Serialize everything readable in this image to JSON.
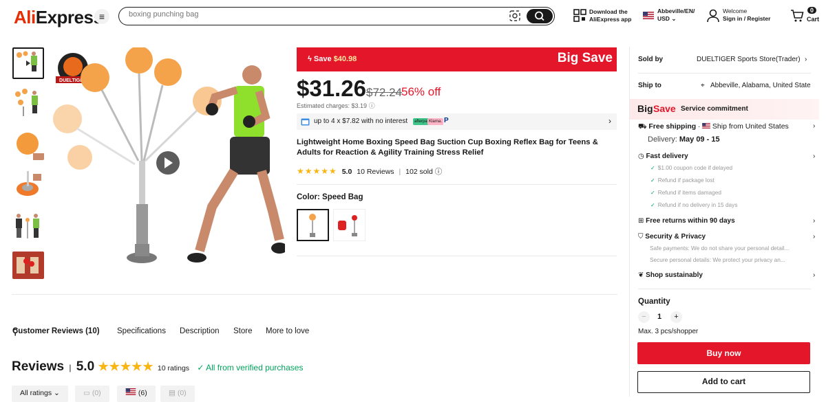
{
  "header": {
    "logo": "AliExpress",
    "search_placeholder": "boxing punching bag",
    "download_line1": "Download the",
    "download_line2": "AliExpress app",
    "locale_line1": "Abbeville/EN/",
    "locale_line2": "USD",
    "welcome": "Welcome",
    "signin": "Sign in / Register",
    "cart_count": "0",
    "cart_label": "Cart"
  },
  "price": {
    "save_prefix": "Save",
    "save_amount": "$40.98",
    "big_save": "Big Save",
    "current": "$31.26",
    "original": "$72.24",
    "discount": "56% off",
    "charges": "Estimated charges: $3.19",
    "installment": "up to 4 x $7.82 with no interest",
    "pay_afterpay": "afterpay",
    "pay_klarna": "Klarna."
  },
  "product": {
    "title": "Lightweight Home Boxing Speed Bag Suction Cup Boxing Reflex Bag for Teens & Adults for Reaction & Agility Training Stress Relief",
    "rating": "5.0",
    "reviews": "10 Reviews",
    "sold": "102 sold",
    "color_label": "Color: Speed Bag",
    "brand_badge": "DUELTIGER"
  },
  "panel": {
    "sold_by_label": "Sold by",
    "sold_by_value": "DUELTIGER Sports Store(Trader)",
    "ship_to_label": "Ship to",
    "ship_to_value": "Abbeville, Alabama, United States",
    "big": "Big",
    "save": "Save",
    "service": "Service commitment",
    "free_shipping": "Free shipping",
    "ship_from": "Ship from United States",
    "delivery_label": "Delivery:",
    "delivery_dates": "May 09 - 15",
    "fast_delivery": "Fast delivery",
    "fast_items": [
      "$1.00 coupon code if delayed",
      "Refund if package lost",
      "Refund if items damaged",
      "Refund if no delivery in 15 days"
    ],
    "free_returns": "Free returns within 90 days",
    "security": "Security & Privacy",
    "security_items": [
      "Safe payments: We do not share your personal detail...",
      "Secure personal details: We protect your privacy an..."
    ],
    "shop_sustainably": "Shop sustainably",
    "quantity_label": "Quantity",
    "quantity_value": "1",
    "max_note": "Max. 3 pcs/shopper",
    "buy_now": "Buy now",
    "add_to_cart": "Add to cart"
  },
  "tabs": [
    "Customer Reviews (10)",
    "Specifications",
    "Description",
    "Store",
    "More to love"
  ],
  "reviews": {
    "heading": "Reviews",
    "score": "5.0",
    "count": "10 ratings",
    "verified": "All from verified purchases",
    "filters": [
      "All ratings",
      "(0)",
      "(6)",
      "(0)"
    ]
  },
  "colors": {
    "accent": "#e4162a",
    "star": "#f9b612",
    "verified": "#00a35b"
  }
}
